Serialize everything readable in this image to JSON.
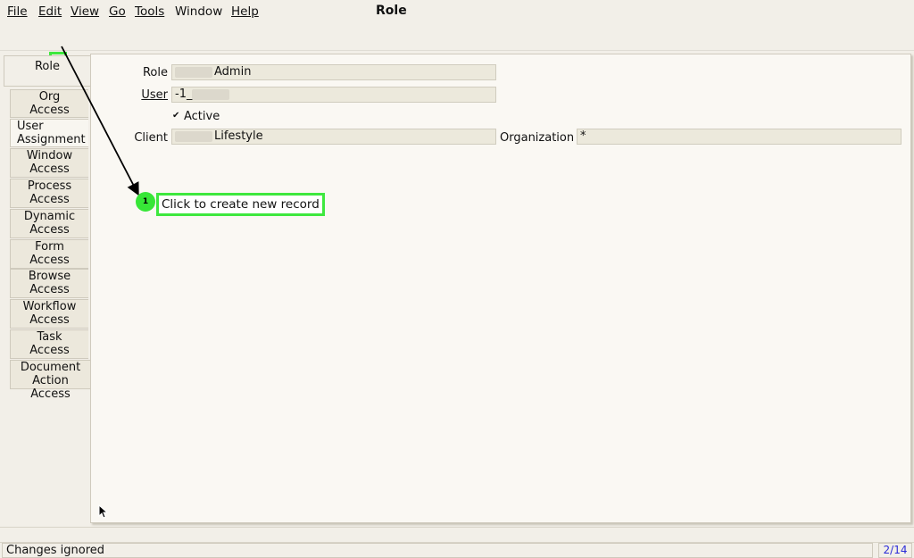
{
  "window_title": "Role",
  "menu": [
    {
      "label": "File",
      "mnemonic": "F"
    },
    {
      "label": "Edit",
      "mnemonic": "E"
    },
    {
      "label": "View",
      "mnemonic": "V"
    },
    {
      "label": "Go",
      "mnemonic": "G"
    },
    {
      "label": "Tools",
      "mnemonic": "T"
    },
    {
      "label": "Window",
      "mnemonic": ""
    },
    {
      "label": "Help",
      "mnemonic": "H"
    }
  ],
  "toolbar_icons": [
    "undo-icon",
    "help-icon",
    "new-record-icon",
    "copy-record-icon",
    "archive-icon",
    "delete-icon",
    "save-icon",
    "refresh-icon",
    "find-icon",
    "attachment-icon",
    "chat-icon",
    "grid-toggle-icon",
    "history-icon",
    "home-icon",
    "previous-icon",
    "next-icon",
    "first-record-icon",
    "previous-record-icon",
    "next-record-icon",
    "last-record-icon",
    "report-icon",
    "archived-documents-icon",
    "print-preview-icon",
    "print-icon",
    "zoom-across-icon",
    "workflow-icon",
    "request-icon",
    "product-info-icon",
    "close-window-icon"
  ],
  "tabs": [
    {
      "label": "Role"
    },
    {
      "label": "Org\nAccess"
    },
    {
      "label": "User\nAssignment"
    },
    {
      "label": "Window\nAccess"
    },
    {
      "label": "Process\nAccess"
    },
    {
      "label": "Dynamic\nAccess"
    },
    {
      "label": "Form\nAccess"
    },
    {
      "label": "Browse\nAccess"
    },
    {
      "label": "Workflow\nAccess"
    },
    {
      "label": "Task\nAccess"
    },
    {
      "label": "Document\nAction Access"
    }
  ],
  "form": {
    "role_label": "Role",
    "role_value": "Admin",
    "user_label": "User",
    "user_value": "-1_",
    "active_label": "Active",
    "active_checked": true,
    "client_label": "Client",
    "client_value": "Lifestyle",
    "organization_label": "Organization",
    "organization_value": "*"
  },
  "annotation": {
    "step_number": "1",
    "text": "Click to create new record"
  },
  "status": {
    "message": "Changes ignored",
    "record_count": "2/14"
  },
  "colors": {
    "highlight_green": "#3ee83e",
    "count_blue": "#2b2bd8"
  }
}
